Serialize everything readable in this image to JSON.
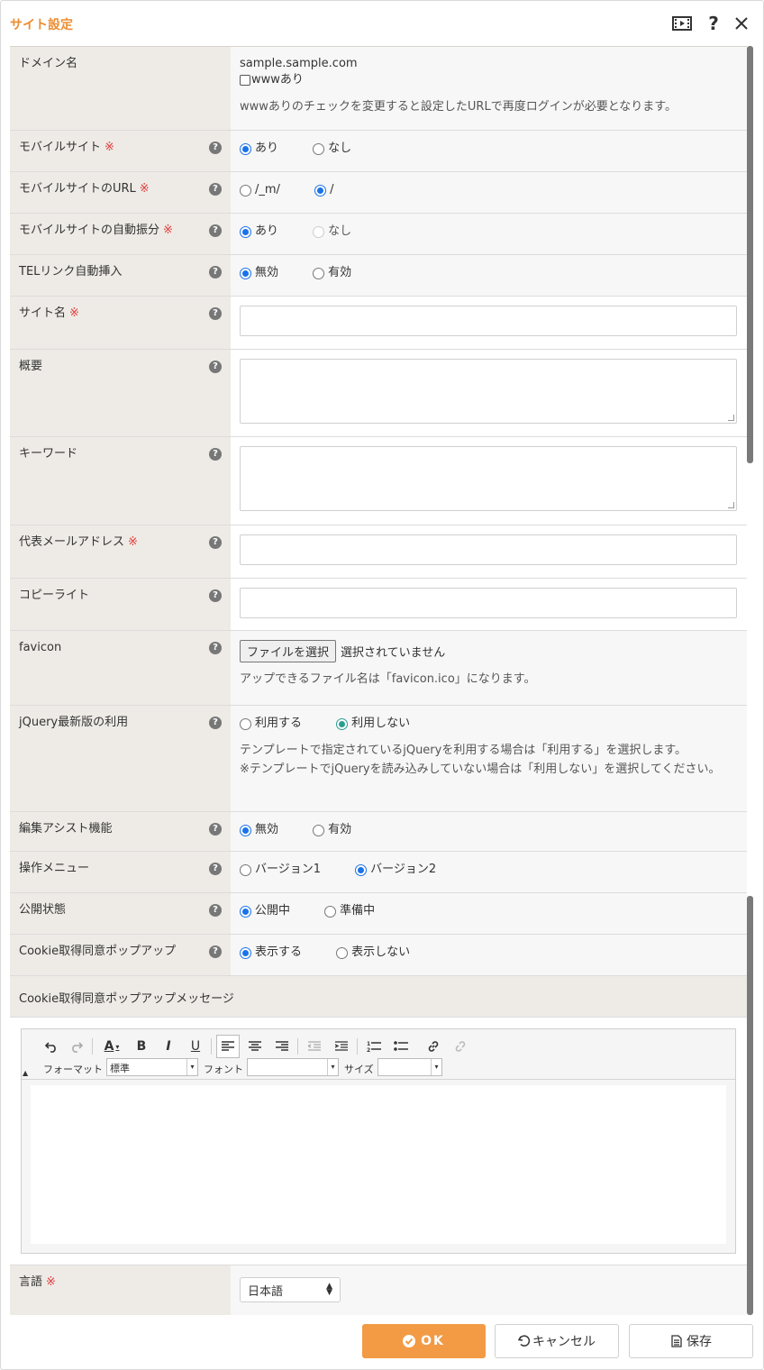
{
  "title": "サイト設定",
  "rows": {
    "domain": {
      "label": "ドメイン名",
      "value": "sample.sample.com",
      "checkbox": "wwwあり",
      "note": "wwwありのチェックを変更すると設定したURLで再度ログインが必要となります。"
    },
    "mobile_site": {
      "label": "モバイルサイト",
      "req": "※",
      "opt1": "あり",
      "opt2": "なし"
    },
    "mobile_url": {
      "label": "モバイルサイトのURL",
      "req": "※",
      "opt1": "/_m/",
      "opt2": "/"
    },
    "mobile_auto": {
      "label": "モバイルサイトの自動振分",
      "req": "※",
      "opt1": "あり",
      "opt2": "なし"
    },
    "tel_link": {
      "label": "TELリンク自動挿入",
      "opt1": "無効",
      "opt2": "有効"
    },
    "site_name": {
      "label": "サイト名",
      "req": "※"
    },
    "summary": {
      "label": "概要"
    },
    "keyword": {
      "label": "キーワード"
    },
    "email": {
      "label": "代表メールアドレス",
      "req": "※"
    },
    "copyright": {
      "label": "コピーライト"
    },
    "favicon": {
      "label": "favicon",
      "button": "ファイルを選択",
      "status": "選択されていません",
      "note": "アップできるファイル名は「favicon.ico」になります。"
    },
    "jquery": {
      "label": "jQuery最新版の利用",
      "opt1": "利用する",
      "opt2": "利用しない",
      "note1": "テンプレートで指定されているjQueryを利用する場合は「利用する」を選択します。",
      "note2": "※テンプレートでjQueryを読み込みしていない場合は「利用しない」を選択してください。"
    },
    "edit_assist": {
      "label": "編集アシスト機能",
      "opt1": "無効",
      "opt2": "有効"
    },
    "op_menu": {
      "label": "操作メニュー",
      "opt1": "バージョン1",
      "opt2": "バージョン2"
    },
    "publish": {
      "label": "公開状態",
      "opt1": "公開中",
      "opt2": "準備中"
    },
    "cookie": {
      "label": "Cookie取得同意ポップアップ",
      "opt1": "表示する",
      "opt2": "表示しない"
    },
    "cookie_msg": {
      "label": "Cookie取得同意ポップアップメッセージ"
    },
    "language": {
      "label": "言語",
      "req": "※",
      "value": "日本語"
    }
  },
  "editor": {
    "format_label": "フォーマット",
    "format_value": "標準",
    "font_label": "フォント",
    "size_label": "サイズ"
  },
  "help_glyph": "?",
  "footer": {
    "ok": "OK",
    "cancel": "キャンセル",
    "save": "保存"
  }
}
